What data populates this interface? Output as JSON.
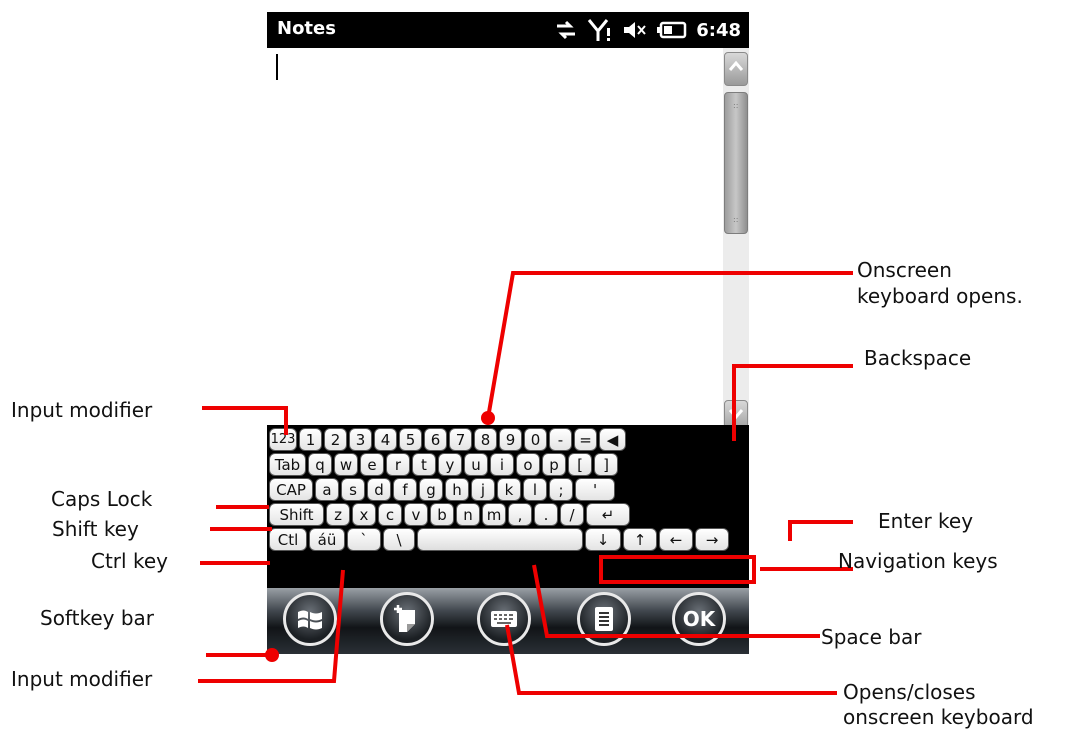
{
  "window": {
    "title": "Notes",
    "clock": "6:48"
  },
  "status_icons": [
    "sync-icon",
    "signal-icon",
    "volume-muted-icon",
    "battery-icon"
  ],
  "keyboard": {
    "rows": [
      [
        "123",
        "1",
        "2",
        "3",
        "4",
        "5",
        "6",
        "7",
        "8",
        "9",
        "0",
        "-",
        "=",
        "◀"
      ],
      [
        "Tab",
        "q",
        "w",
        "e",
        "r",
        "t",
        "y",
        "u",
        "i",
        "o",
        "p",
        "[",
        "]"
      ],
      [
        "CAP",
        "a",
        "s",
        "d",
        "f",
        "g",
        "h",
        "j",
        "k",
        "l",
        ";",
        "'"
      ],
      [
        "Shift",
        "z",
        "x",
        "c",
        "v",
        "b",
        "n",
        "m",
        ",",
        ".",
        "/",
        "↵"
      ],
      [
        "Ctl",
        "áü",
        "`",
        "\\",
        " ",
        "↓",
        "↑",
        "←",
        "→"
      ]
    ]
  },
  "softkeys": [
    {
      "name": "start-button",
      "icon": "windows-flag-icon"
    },
    {
      "name": "new-note-button",
      "icon": "new-note-icon"
    },
    {
      "name": "sip-keyboard-button",
      "icon": "keyboard-icon"
    },
    {
      "name": "menu-button",
      "icon": "list-icon"
    },
    {
      "name": "ok-button",
      "label": "OK"
    }
  ],
  "callouts": {
    "onscreen_opens_1": "Onscreen",
    "onscreen_opens_2": "keyboard opens.",
    "backspace": "Backspace",
    "input_modifier_top": "Input modifier",
    "caps_lock": "Caps Lock",
    "shift_key": "Shift key",
    "ctrl_key": "Ctrl key",
    "softkey_bar": "Softkey bar",
    "input_modifier_bottom": "Input modifier",
    "enter_key": "Enter key",
    "navigation_keys": "Navigation keys",
    "space_bar": "Space bar",
    "opens_closes_1": "Opens/closes",
    "opens_closes_2": "onscreen keyboard"
  },
  "colors": {
    "leader": "#ee0000",
    "titlebar": "#000000"
  }
}
